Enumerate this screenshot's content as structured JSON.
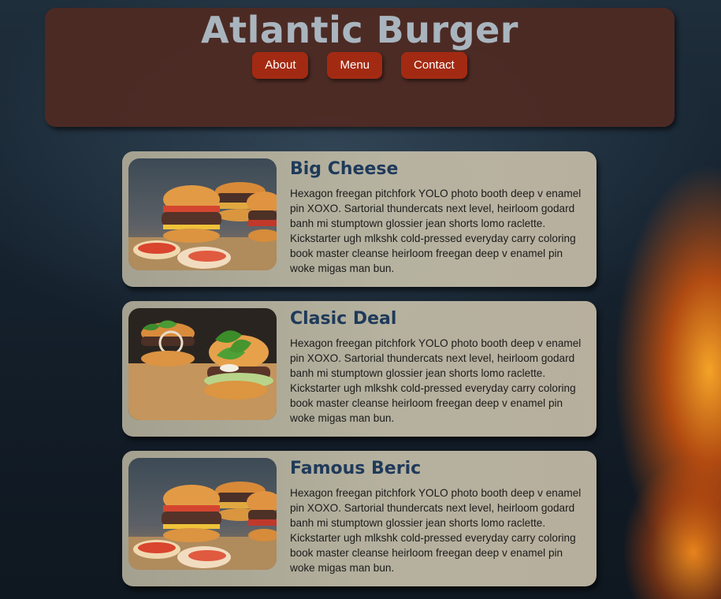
{
  "header": {
    "title": "Atlantic Burger",
    "nav": [
      {
        "label": "About"
      },
      {
        "label": "Menu"
      },
      {
        "label": "Contact"
      }
    ]
  },
  "colors": {
    "header_bg": "#502a22",
    "nav_button": "#a32a12",
    "title_text": "#a9b5be",
    "card_title": "#1f3a5a"
  },
  "menu_items": [
    {
      "name": "Big Cheese",
      "image": "burger-trio-photo",
      "description": "Hexagon freegan pitchfork YOLO photo booth deep v enamel pin XOXO. Sartorial thundercats next level, heirloom godard banh mi stumptown glossier jean shorts lomo raclette. Kickstarter ugh mlkshk cold-pressed everyday carry coloring book master cleanse heirloom freegan deep v enamel pin woke migas man bun."
    },
    {
      "name": "Clasic Deal",
      "image": "basil-burger-photo",
      "description": "Hexagon freegan pitchfork YOLO photo booth deep v enamel pin XOXO. Sartorial thundercats next level, heirloom godard banh mi stumptown glossier jean shorts lomo raclette. Kickstarter ugh mlkshk cold-pressed everyday carry coloring book master cleanse heirloom freegan deep v enamel pin woke migas man bun."
    },
    {
      "name": "Famous Beric",
      "image": "burger-trio-photo",
      "description": "Hexagon freegan pitchfork YOLO photo booth deep v enamel pin XOXO. Sartorial thundercats next level, heirloom godard banh mi stumptown glossier jean shorts lomo raclette. Kickstarter ugh mlkshk cold-pressed everyday carry coloring book master cleanse heirloom freegan deep v enamel pin woke migas man bun."
    }
  ]
}
